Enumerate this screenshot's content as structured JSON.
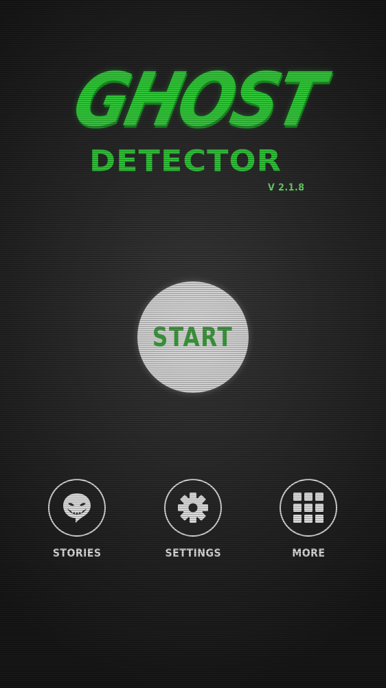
{
  "app": {
    "title_line1": "GHOST",
    "title_line2": "DETECTOR",
    "version": "V 2.1.8"
  },
  "start_button": {
    "label": "START"
  },
  "nav": [
    {
      "label": "STORIES",
      "icon": "ghost-face-icon"
    },
    {
      "label": "SETTINGS",
      "icon": "gear-icon"
    },
    {
      "label": "MORE",
      "icon": "grid-icon"
    }
  ],
  "colors": {
    "accent_green": "#32d23a",
    "button_bg": "#e0e0e0",
    "icon_white": "#e8e8e8",
    "background": "#2a2a2a"
  }
}
